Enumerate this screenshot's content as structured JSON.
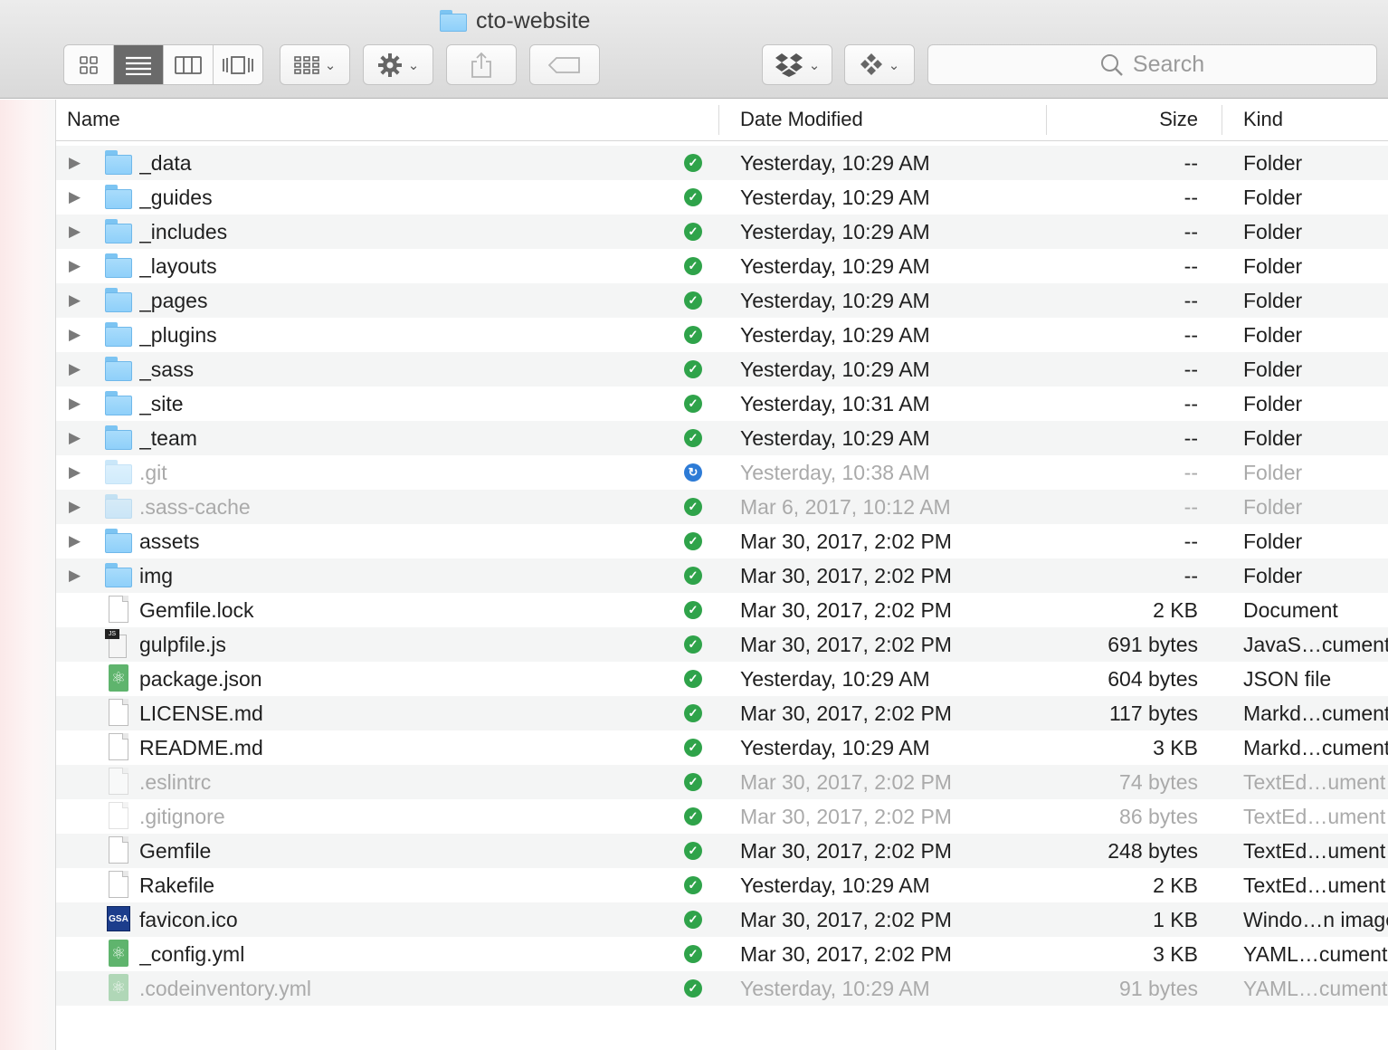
{
  "window": {
    "title": "cto-website"
  },
  "toolbar": {
    "view_modes": [
      "icon-view",
      "list-view",
      "column-view",
      "cover-flow-view"
    ],
    "active_view": 1,
    "search_placeholder": "Search"
  },
  "columns": {
    "name": "Name",
    "date": "Date Modified",
    "size": "Size",
    "kind": "Kind"
  },
  "files": [
    {
      "name": "_data",
      "date": "Yesterday, 10:29 AM",
      "size": "--",
      "kind": "Folder",
      "icon": "folder",
      "dim": false,
      "status": "synced"
    },
    {
      "name": "_guides",
      "date": "Yesterday, 10:29 AM",
      "size": "--",
      "kind": "Folder",
      "icon": "folder",
      "dim": false,
      "status": "synced"
    },
    {
      "name": "_includes",
      "date": "Yesterday, 10:29 AM",
      "size": "--",
      "kind": "Folder",
      "icon": "folder",
      "dim": false,
      "status": "synced"
    },
    {
      "name": "_layouts",
      "date": "Yesterday, 10:29 AM",
      "size": "--",
      "kind": "Folder",
      "icon": "folder",
      "dim": false,
      "status": "synced"
    },
    {
      "name": "_pages",
      "date": "Yesterday, 10:29 AM",
      "size": "--",
      "kind": "Folder",
      "icon": "folder",
      "dim": false,
      "status": "synced"
    },
    {
      "name": "_plugins",
      "date": "Yesterday, 10:29 AM",
      "size": "--",
      "kind": "Folder",
      "icon": "folder",
      "dim": false,
      "status": "synced"
    },
    {
      "name": "_sass",
      "date": "Yesterday, 10:29 AM",
      "size": "--",
      "kind": "Folder",
      "icon": "folder",
      "dim": false,
      "status": "synced"
    },
    {
      "name": "_site",
      "date": "Yesterday, 10:31 AM",
      "size": "--",
      "kind": "Folder",
      "icon": "folder",
      "dim": false,
      "status": "synced"
    },
    {
      "name": "_team",
      "date": "Yesterday, 10:29 AM",
      "size": "--",
      "kind": "Folder",
      "icon": "folder",
      "dim": false,
      "status": "synced"
    },
    {
      "name": ".git",
      "date": "Yesterday, 10:38 AM",
      "size": "--",
      "kind": "Folder",
      "icon": "folder",
      "dim": true,
      "status": "syncing"
    },
    {
      "name": ".sass-cache",
      "date": "Mar 6, 2017, 10:12 AM",
      "size": "--",
      "kind": "Folder",
      "icon": "folder",
      "dim": true,
      "status": "synced"
    },
    {
      "name": "assets",
      "date": "Mar 30, 2017, 2:02 PM",
      "size": "--",
      "kind": "Folder",
      "icon": "folder",
      "dim": false,
      "status": "synced"
    },
    {
      "name": "img",
      "date": "Mar 30, 2017, 2:02 PM",
      "size": "--",
      "kind": "Folder",
      "icon": "folder",
      "dim": false,
      "status": "synced"
    },
    {
      "name": "Gemfile.lock",
      "date": "Mar 30, 2017, 2:02 PM",
      "size": "2 KB",
      "kind": "Document",
      "icon": "document",
      "dim": false,
      "status": "synced"
    },
    {
      "name": "gulpfile.js",
      "date": "Mar 30, 2017, 2:02 PM",
      "size": "691 bytes",
      "kind": "JavaS…cument",
      "icon": "js",
      "dim": false,
      "status": "synced"
    },
    {
      "name": "package.json",
      "date": "Yesterday, 10:29 AM",
      "size": "604 bytes",
      "kind": "JSON file",
      "icon": "atom",
      "dim": false,
      "status": "synced"
    },
    {
      "name": "LICENSE.md",
      "date": "Mar 30, 2017, 2:02 PM",
      "size": "117 bytes",
      "kind": "Markd…cument",
      "icon": "document",
      "dim": false,
      "status": "synced"
    },
    {
      "name": "README.md",
      "date": "Yesterday, 10:29 AM",
      "size": "3 KB",
      "kind": "Markd…cument",
      "icon": "document",
      "dim": false,
      "status": "synced"
    },
    {
      "name": ".eslintrc",
      "date": "Mar 30, 2017, 2:02 PM",
      "size": "74 bytes",
      "kind": "TextEd…ument",
      "icon": "document",
      "dim": true,
      "status": "synced"
    },
    {
      "name": ".gitignore",
      "date": "Mar 30, 2017, 2:02 PM",
      "size": "86 bytes",
      "kind": "TextEd…ument",
      "icon": "document",
      "dim": true,
      "status": "synced"
    },
    {
      "name": "Gemfile",
      "date": "Mar 30, 2017, 2:02 PM",
      "size": "248 bytes",
      "kind": "TextEd…ument",
      "icon": "document",
      "dim": false,
      "status": "synced"
    },
    {
      "name": "Rakefile",
      "date": "Yesterday, 10:29 AM",
      "size": "2 KB",
      "kind": "TextEd…ument",
      "icon": "document",
      "dim": false,
      "status": "synced"
    },
    {
      "name": "favicon.ico",
      "date": "Mar 30, 2017, 2:02 PM",
      "size": "1 KB",
      "kind": "Windo…n image",
      "icon": "ico",
      "dim": false,
      "status": "synced"
    },
    {
      "name": "_config.yml",
      "date": "Mar 30, 2017, 2:02 PM",
      "size": "3 KB",
      "kind": "YAML…cument",
      "icon": "atom",
      "dim": false,
      "status": "synced"
    },
    {
      "name": ".codeinventory.yml",
      "date": "Yesterday, 10:29 AM",
      "size": "91 bytes",
      "kind": "YAML…cument",
      "icon": "atom",
      "dim": true,
      "status": "synced"
    }
  ]
}
